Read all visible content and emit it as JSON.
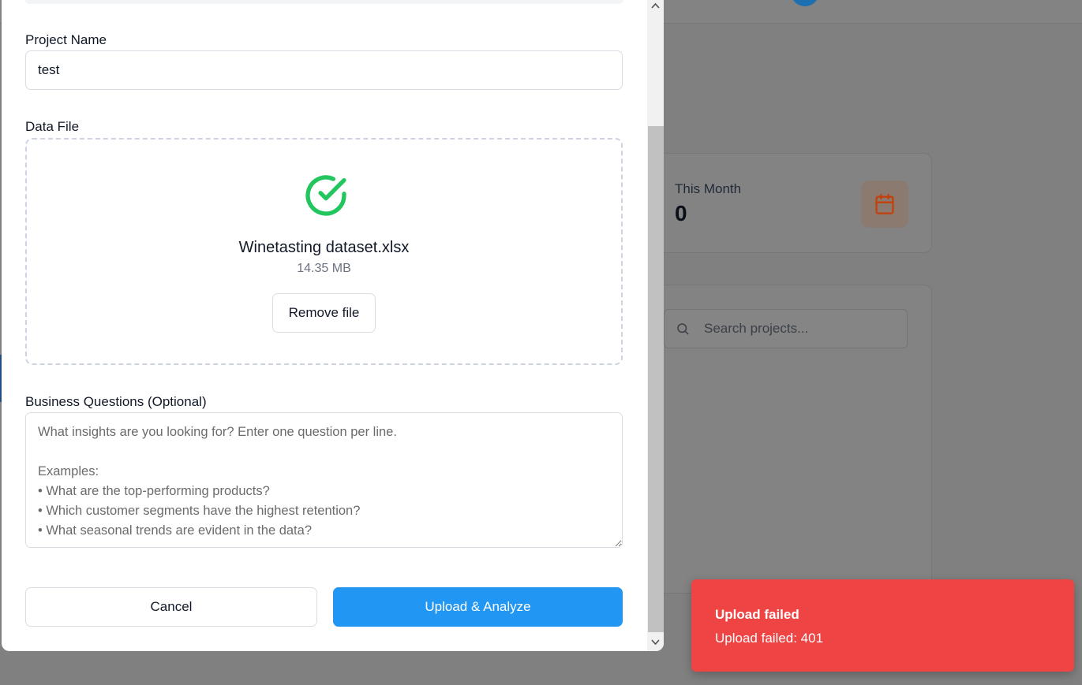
{
  "background": {
    "stat_card": {
      "label": "This Month",
      "value": "0",
      "icon": "calendar-icon"
    },
    "search": {
      "placeholder": "Search projects...",
      "icon": "search-icon"
    }
  },
  "form": {
    "project_name": {
      "label": "Project Name",
      "value": "test"
    },
    "data_file": {
      "label": "Data File",
      "status_icon": "check-circle-icon",
      "file_name": "Winetasting dataset.xlsx",
      "file_size": "14.35 MB",
      "remove_label": "Remove file"
    },
    "business_questions": {
      "label": "Business Questions (Optional)",
      "placeholder": "What insights are you looking for? Enter one question per line.\n\nExamples:\n• What are the top-performing products?\n• Which customer segments have the highest retention?\n• What seasonal trends are evident in the data?"
    },
    "cancel_label": "Cancel",
    "submit_label": "Upload & Analyze"
  },
  "toast": {
    "title": "Upload failed",
    "message": "Upload failed: 401"
  },
  "colors": {
    "primary": "#2196f3",
    "success": "#22c55e",
    "error": "#ef4444",
    "calendar_accent": "#c2410c"
  }
}
